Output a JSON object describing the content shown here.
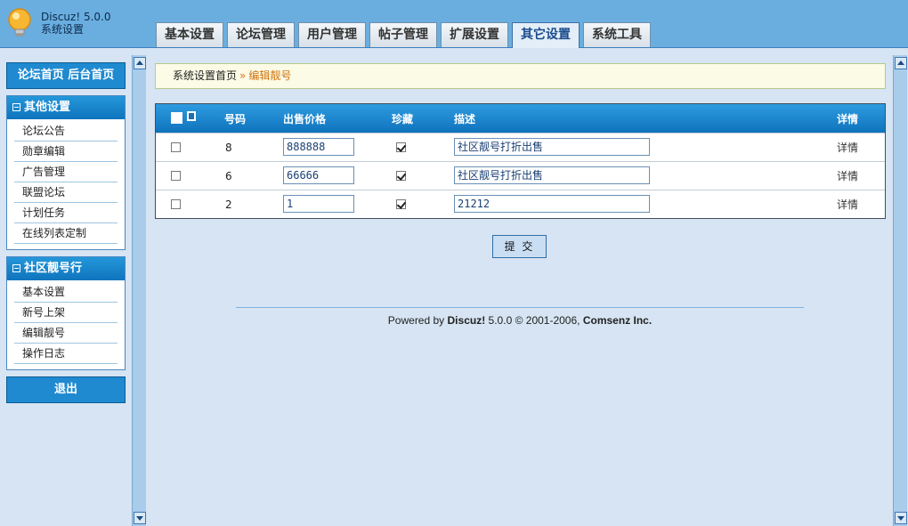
{
  "header": {
    "brand_name": "Discuz! 5.0.0",
    "brand_sub": "系统设置",
    "tabs": [
      {
        "label": "基本设置"
      },
      {
        "label": "论坛管理"
      },
      {
        "label": "用户管理"
      },
      {
        "label": "帖子管理"
      },
      {
        "label": "扩展设置"
      },
      {
        "label": "其它设置",
        "active": true
      },
      {
        "label": "系统工具"
      }
    ]
  },
  "sidebar": {
    "top_links": "论坛首页 后台首页",
    "menu1": {
      "title": "其他设置",
      "items": [
        "论坛公告",
        "勋章编辑",
        "广告管理",
        "联盟论坛",
        "计划任务",
        "在线列表定制"
      ]
    },
    "menu2": {
      "title": "社区靓号行",
      "items": [
        "基本设置",
        "新号上架",
        "编辑靓号",
        "操作日志"
      ]
    },
    "logout": "退出"
  },
  "breadcrumb": {
    "home": "系统设置首页",
    "sep": "»",
    "current": "编辑靓号"
  },
  "table": {
    "columns": {
      "number": "号码",
      "price": "出售价格",
      "collect": "珍藏",
      "desc": "描述",
      "detail": "详情"
    },
    "rows": [
      {
        "number": "8",
        "price": "888888",
        "collected": true,
        "desc": "社区靓号打折出售",
        "detail": "详情"
      },
      {
        "number": "6",
        "price": "66666",
        "collected": true,
        "desc": "社区靓号打折出售",
        "detail": "详情"
      },
      {
        "number": "2",
        "price": "1",
        "collected": true,
        "desc": "21212",
        "detail": "详情"
      }
    ]
  },
  "submit_label": "提 交",
  "footer": {
    "powered": "Powered by",
    "product": "Discuz!",
    "version": "5.0.0",
    "copyright": "© 2001-2006,",
    "company": "Comsenz Inc."
  },
  "colors": {
    "header_bg": "#6aaee0",
    "page_bg": "#d6e4f3",
    "menu_blue": "#1f8ad0",
    "breadcrumb_current": "#d0730e"
  }
}
